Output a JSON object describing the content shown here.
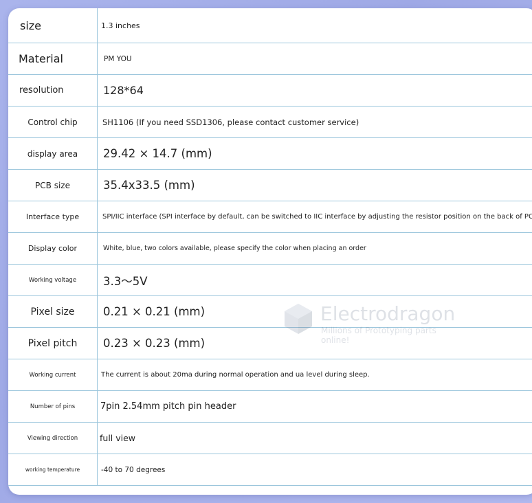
{
  "specs": [
    {
      "label": "size",
      "value": "1.3 inches"
    },
    {
      "label": "Material",
      "value": "PM YOU"
    },
    {
      "label": "resolution",
      "value": "128*64"
    },
    {
      "label": "Control chip",
      "value": "SH1106 (If you need SSD1306, please contact customer service)"
    },
    {
      "label": "display area",
      "value": "29.42 × 14.7 (mm)"
    },
    {
      "label": "PCB size",
      "value": "35.4x33.5 (mm)"
    },
    {
      "label": "Interface type",
      "value": "SPI/IIC interface (SPI interface by default, can be switched to IIC interface by adjusting the resistor position on the back of PCB)"
    },
    {
      "label": "Display color",
      "value": "White, blue, two colors available, please specify the color when placing an order"
    },
    {
      "label": "Working voltage",
      "value": "3.3～5V"
    },
    {
      "label": "Pixel size",
      "value": "0.21 × 0.21 (mm)"
    },
    {
      "label": "Pixel pitch",
      "value": "0.23 × 0.23 (mm)"
    },
    {
      "label": "Working current",
      "value": "The current is about 20ma during normal operation and ua level during sleep."
    },
    {
      "label": "Number of pins",
      "value": "7pin 2.54mm pitch pin header"
    },
    {
      "label": "Viewing direction",
      "value": "full view"
    },
    {
      "label": "working temperature",
      "value": "-40 to 70 degrees"
    }
  ],
  "watermark": {
    "title": "Electrodragon",
    "subtitle": "Millions of Prototyping parts online!"
  },
  "colors": {
    "border": "#9cc6dc",
    "background": "#a4aeea"
  }
}
